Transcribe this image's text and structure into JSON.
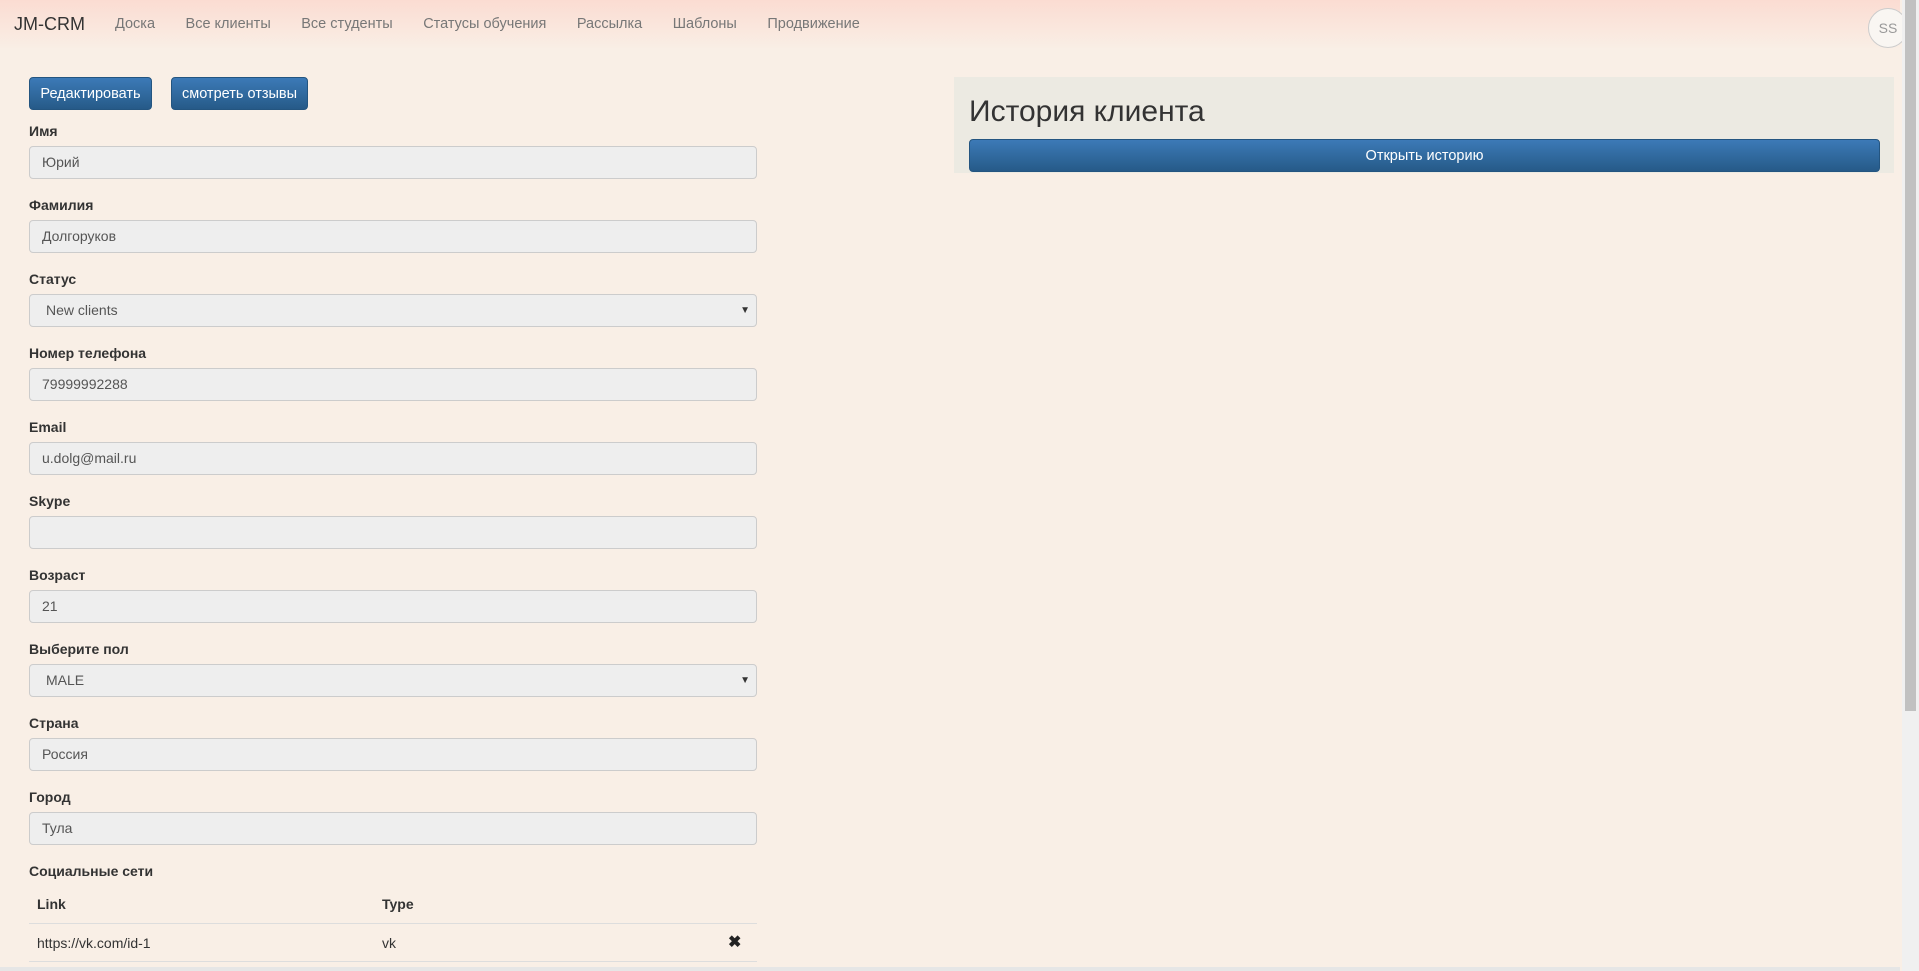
{
  "navbar": {
    "brand": "JM-CRM",
    "items": [
      "Доска",
      "Все клиенты",
      "Все студенты",
      "Статусы обучения",
      "Рассылка",
      "Шаблоны",
      "Продвижение"
    ],
    "avatar_initials": "SS"
  },
  "actions": {
    "edit_label": "Редактировать",
    "reviews_label": "смотреть отзывы"
  },
  "form": {
    "first_name": {
      "label": "Имя",
      "value": "Юрий"
    },
    "last_name": {
      "label": "Фамилия",
      "value": "Долгоруков"
    },
    "status": {
      "label": "Статус",
      "value": "New clients"
    },
    "phone": {
      "label": "Номер телефона",
      "value": "79999992288"
    },
    "email": {
      "label": "Email",
      "value": "u.dolg@mail.ru"
    },
    "skype": {
      "label": "Skype",
      "value": ""
    },
    "age": {
      "label": "Возраст",
      "value": "21"
    },
    "gender": {
      "label": "Выберите пол",
      "value": "MALE"
    },
    "country": {
      "label": "Страна",
      "value": "Россия"
    },
    "city": {
      "label": "Город",
      "value": "Тула"
    }
  },
  "social": {
    "label": "Социальные сети",
    "columns": [
      "Link",
      "Type"
    ],
    "rows": [
      {
        "link": "https://vk.com/id-1",
        "type": "vk"
      }
    ]
  },
  "history": {
    "title": "История клиента",
    "button_label": "Открыть историю"
  },
  "colors": {
    "background": "#f9efe6",
    "button_blue": "#2d6ca2",
    "panel": "#eceae2"
  }
}
